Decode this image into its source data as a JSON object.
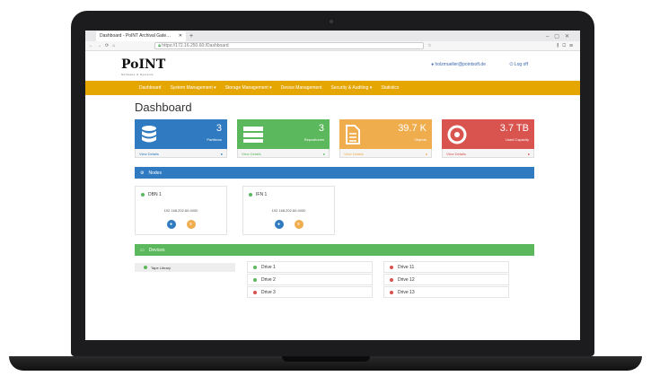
{
  "browser": {
    "tab_title": "Dashboard - PoINT Archival Gate…",
    "url": "https://172.16.250.60:/Dashboard"
  },
  "header": {
    "logo_text": "PoINT",
    "logo_tagline": "Software & Systems",
    "user_email": "holzmueller@pointsoft.de",
    "logout_label": "Log off"
  },
  "nav": {
    "items": [
      {
        "label": "Dashboard"
      },
      {
        "label": "System Management ▾"
      },
      {
        "label": "Storage Management ▾"
      },
      {
        "label": "Device Management"
      },
      {
        "label": "Security & Auditing ▾"
      },
      {
        "label": "Statistics"
      }
    ]
  },
  "page_title": "Dashboard",
  "cards": [
    {
      "value": "3",
      "label": "Partitions",
      "link": "View Details",
      "color": "#2f7ac0"
    },
    {
      "value": "3",
      "label": "Repositories",
      "link": "View Details",
      "color": "#5cb85c"
    },
    {
      "value": "39.7 K",
      "label": "Objects",
      "link": "View Details",
      "color": "#f0ad4e"
    },
    {
      "value": "3.7 TB",
      "label": "Used Capacity",
      "link": "View Details",
      "color": "#d9534f"
    }
  ],
  "nodes_panel": {
    "title": "Nodes",
    "nodes": [
      {
        "name": "DBN 1",
        "ip": "192.168.202.60:4000",
        "status": "online"
      },
      {
        "name": "IFN 1",
        "ip": "192.168.202.60:4000",
        "status": "online"
      }
    ]
  },
  "devices_panel": {
    "title": "Devices",
    "tab_label": "Tape Library",
    "drives_left": [
      {
        "label": "Drive 1",
        "status": "online"
      },
      {
        "label": "Drive 2",
        "status": "online"
      },
      {
        "label": "Drive 3",
        "status": "offline"
      }
    ],
    "drives_right": [
      {
        "label": "Drive 11",
        "status": "offline"
      },
      {
        "label": "Drive 12",
        "status": "offline"
      },
      {
        "label": "Drive 13",
        "status": "offline"
      }
    ]
  }
}
